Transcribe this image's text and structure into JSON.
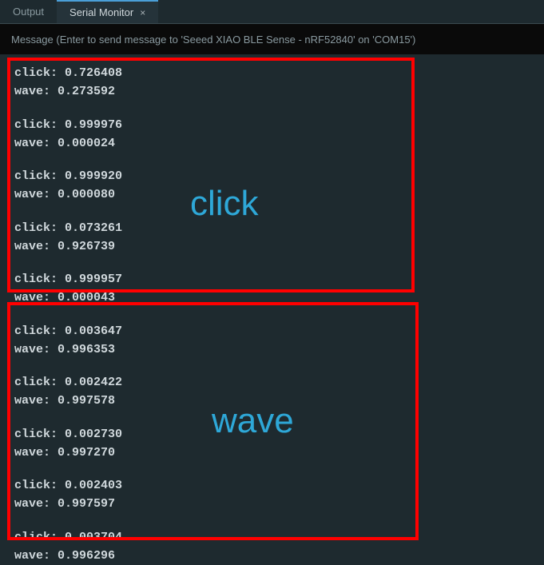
{
  "tabs": {
    "output": "Output",
    "serial_monitor": "Serial Monitor",
    "close_icon": "×"
  },
  "message_bar": {
    "placeholder": "Message (Enter to send message to 'Seeed XIAO BLE Sense - nRF52840' on 'COM15')"
  },
  "serial_output": {
    "click_section": [
      {
        "click": "0.726408",
        "wave": "0.273592"
      },
      {
        "click": "0.999976",
        "wave": "0.000024"
      },
      {
        "click": "0.999920",
        "wave": "0.000080"
      },
      {
        "click": "0.073261",
        "wave": "0.926739"
      },
      {
        "click": "0.999957",
        "wave": "0.000043"
      }
    ],
    "wave_section": [
      {
        "click": "0.003647",
        "wave": "0.996353"
      },
      {
        "click": "0.002422",
        "wave": "0.997578"
      },
      {
        "click": "0.002730",
        "wave": "0.997270"
      },
      {
        "click": "0.002403",
        "wave": "0.997597"
      },
      {
        "click": "0.003704",
        "wave": "0.996296"
      }
    ],
    "click_label": "click:",
    "wave_label": "wave:"
  },
  "annotations": {
    "click": "click",
    "wave": "wave"
  }
}
